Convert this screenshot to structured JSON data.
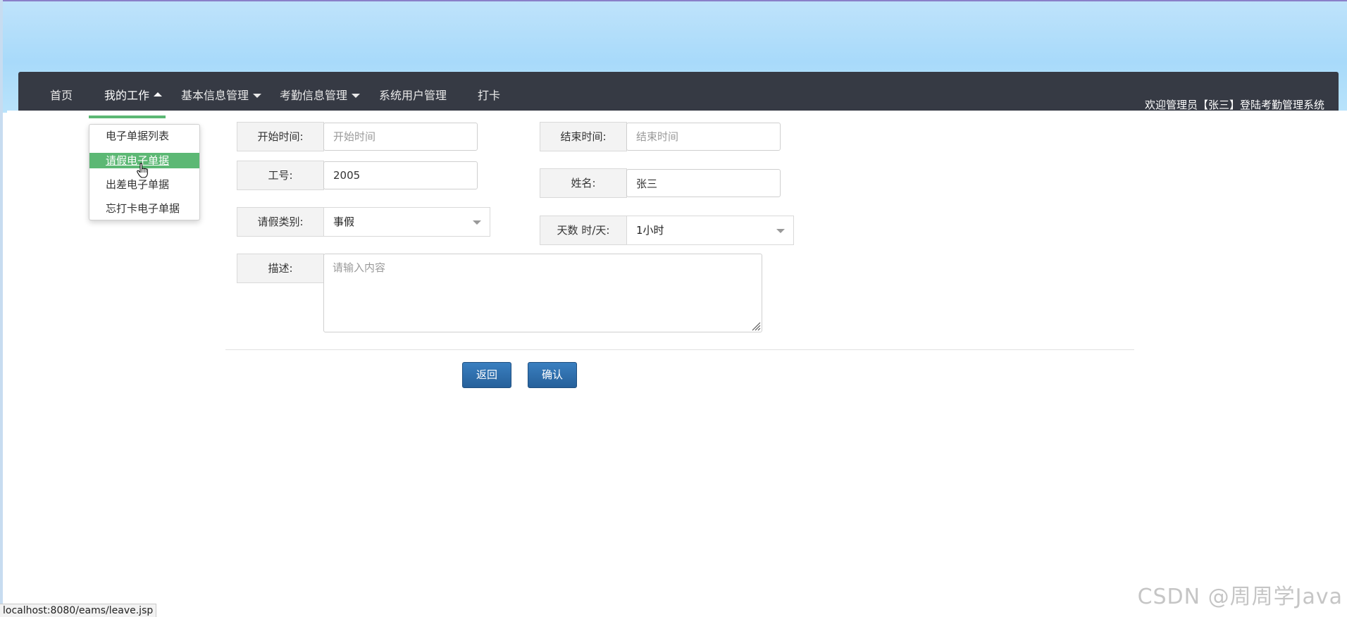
{
  "navbar": {
    "items": [
      {
        "label": "首页"
      },
      {
        "label": "我的工作"
      },
      {
        "label": "基本信息管理"
      },
      {
        "label": "考勤信息管理"
      },
      {
        "label": "系统用户管理"
      },
      {
        "label": "打卡"
      }
    ],
    "welcome": "欢迎管理员【张三】登陆考勤管理系统"
  },
  "dropdown": {
    "items": [
      {
        "label": "电子单据列表"
      },
      {
        "label": "请假电子单据",
        "active": true
      },
      {
        "label": "出差电子单据"
      },
      {
        "label": "忘打卡电子单据"
      }
    ]
  },
  "form": {
    "start_time": {
      "label": "开始时间:",
      "placeholder": "开始时间",
      "value": ""
    },
    "end_time": {
      "label": "结束时间:",
      "placeholder": "结束时间",
      "value": ""
    },
    "job_no": {
      "label": "工号:",
      "value": "2005"
    },
    "name": {
      "label": "姓名:",
      "value": "张三"
    },
    "leave_type": {
      "label": "请假类别:",
      "value": "事假"
    },
    "days": {
      "label": "天数 时/天:",
      "value": "1小时"
    },
    "description": {
      "label": "描述:",
      "placeholder": "请输入内容"
    }
  },
  "buttons": {
    "back": "返回",
    "confirm": "确认"
  },
  "status_bar": {
    "url": "localhost:8080/eams/leave.jsp"
  },
  "watermark": "CSDN @周周学Java",
  "colors": {
    "navbar": "#363a44",
    "accent_green": "#5cb874",
    "button_blue": "#2b6aa8"
  }
}
